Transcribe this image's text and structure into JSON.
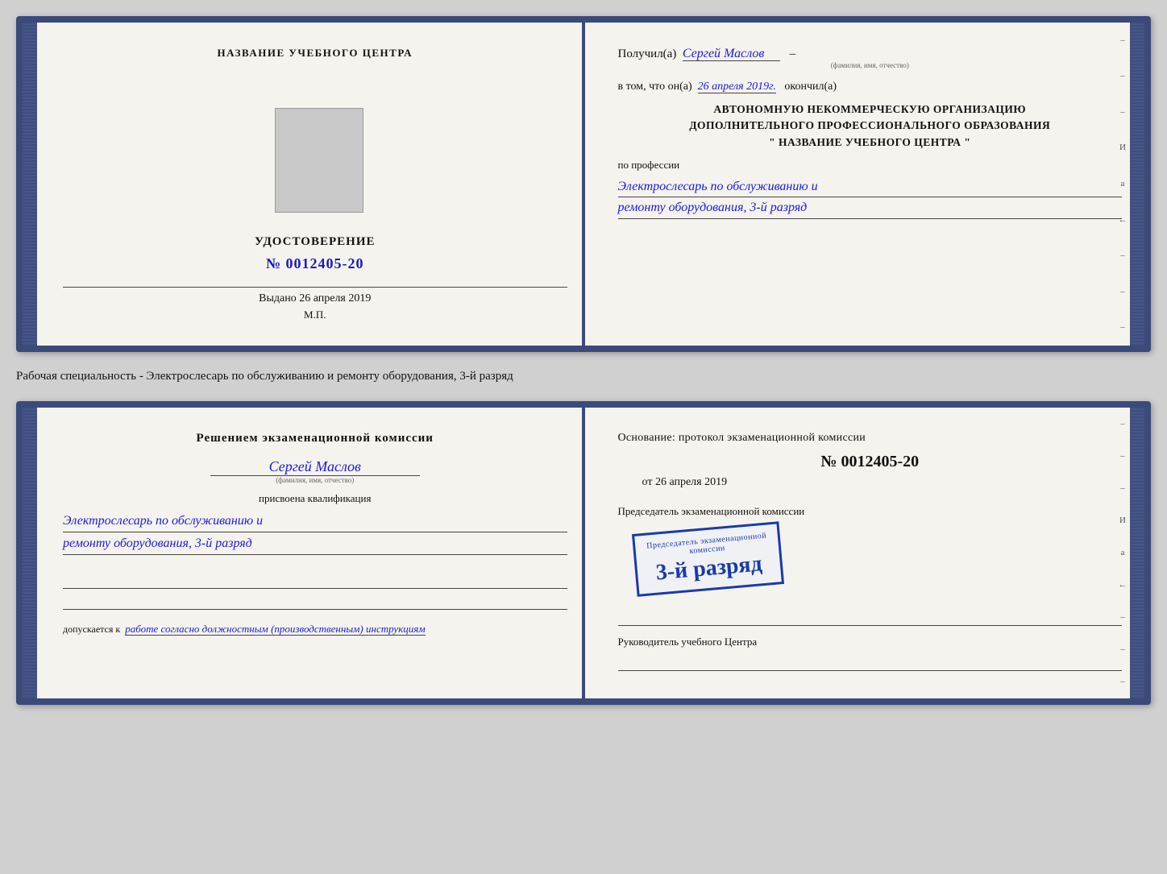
{
  "top_card": {
    "left": {
      "header": "НАЗВАНИЕ УЧЕБНОГО ЦЕНТРА",
      "photo_alt": "Фото",
      "udostoverenie": "УДОСТОВЕРЕНИЕ",
      "number_label": "№",
      "number_value": "0012405-20",
      "vydano_label": "Выдано",
      "vydano_date": "26 апреля 2019",
      "mp_label": "М.П."
    },
    "right": {
      "poluchil_label": "Получил(а)",
      "poluchil_name": "Сергей Маслов",
      "fio_sublabel": "(фамилия, имя, отчество)",
      "vtom_prefix": "в том, что он(а)",
      "vtom_date": "26 апреля 2019г.",
      "okonchil_label": "окончил(а)",
      "org_line1": "АВТОНОМНУЮ НЕКОММЕРЧЕСКУЮ ОРГАНИЗАЦИЮ",
      "org_line2": "ДОПОЛНИТЕЛЬНОГО ПРОФЕССИОНАЛЬНОГО ОБРАЗОВАНИЯ",
      "org_line3": "\" НАЗВАНИЕ УЧЕБНОГО ЦЕНТРА \"",
      "po_professii_label": "по профессии",
      "profession_line1": "Электрослесарь по обслуживанию и",
      "profession_line2": "ремонту оборудования, 3-й разряд"
    }
  },
  "between_label": "Рабочая специальность - Электрослесарь по обслуживанию и ремонту оборудования, 3-й разряд",
  "bottom_card": {
    "left": {
      "decision_title": "Решением экзаменационной комиссии",
      "name": "Сергей Маслов",
      "fio_sublabel": "(фамилия, имя, отчество)",
      "prisvoena": "присвоена квалификация",
      "qualification_line1": "Электрослесарь по обслуживанию и",
      "qualification_line2": "ремонту оборудования, 3-й разряд",
      "dopuskaetsya_label": "допускается к",
      "dopuskaetsya_value": "работе согласно должностным (производственным) инструкциям"
    },
    "right": {
      "osnovanje_label": "Основание: протокол экзаменационной комиссии",
      "number_prefix": "№",
      "number_value": "0012405-20",
      "ot_label": "от",
      "ot_date": "26 апреля 2019",
      "predsedatel_label": "Председатель экзаменационной комиссии",
      "stamp_top": "Предcедатель экзаменационной",
      "stamp_main": "3-й разряд",
      "rukovoditel_label": "Руководитель учебного Центра"
    }
  },
  "side_dashes": [
    "-",
    "-",
    "-",
    "И",
    "а",
    "←",
    "-",
    "-",
    "-"
  ],
  "side_dashes_bottom": [
    "-",
    "-",
    "-",
    "И",
    "а",
    "←",
    "-",
    "-",
    "-"
  ]
}
